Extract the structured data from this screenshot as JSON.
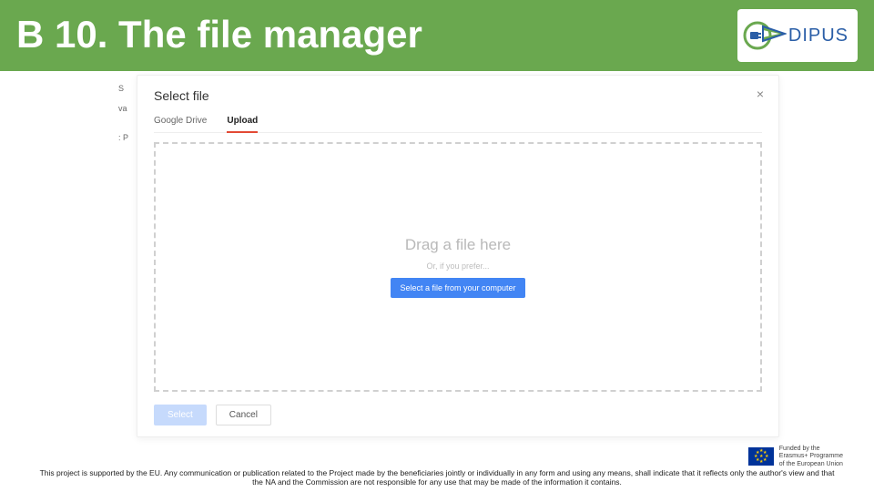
{
  "header": {
    "title": "B 10. The file manager",
    "logo_text": "DIPUS"
  },
  "modal": {
    "title": "Select file",
    "close": "×",
    "tabs": {
      "drive": "Google Drive",
      "upload": "Upload"
    },
    "dropzone": {
      "drag": "Drag a file here",
      "or": "Or, if you prefer...",
      "button": "Select a file from your computer"
    },
    "footer": {
      "select": "Select",
      "cancel": "Cancel"
    }
  },
  "bg": {
    "s": "S",
    "va": "va",
    "p": ": P"
  },
  "eu": {
    "line1": "Funded by the",
    "line2": "Erasmus+ Programme",
    "line3": "of the European Union"
  },
  "disclaimer": "This project is supported by the EU. Any communication or publication related to the Project made by the beneficiaries jointly or individually in any form and using any means, shall indicate that it reflects only the author's view and that the NA and the Commission are not responsible for any use that may be made of the information it contains."
}
